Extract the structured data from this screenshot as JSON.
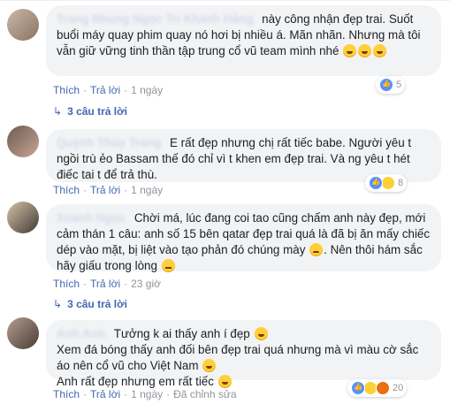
{
  "comments": [
    {
      "author": "Trang Nhung Ngọc Trí Khánh Hằng",
      "text": "này công nhận đẹp trai. Suốt buổi máy quay phim quay nó hơi bị nhiều á. Mãn nhãn. Nhưng mà tôi vẫn giữ vững tinh thần tập trung cổ vũ team mình nhé",
      "like_label": "Thích",
      "reply_label": "Trả lời",
      "time": "1 ngày",
      "reaction_count": "5",
      "replies_label": "3 câu trả lời"
    },
    {
      "author": "Quỳnh Thủy Trang",
      "text": "E rất đẹp nhưng chị rất tiếc babe. Người yêu t ngồi trù ẻo Bassam thế đó chỉ vì t khen em đẹp trai. Và ng yêu t hét điếc tai t để trả thù.",
      "like_label": "Thích",
      "reply_label": "Trả lời",
      "time": "1 ngày",
      "reaction_count": "8"
    },
    {
      "author": "Xoanh Ngọc",
      "text": "Chời má, lúc đang coi tao cũng chấm anh này đẹp, mới cảm thán 1 câu: anh số 15 bên qatar đẹp trai quá là đã bị ăn mấy chiếc dép vào mặt, bị liệt vào tạo phản đó chúng mày",
      "text_tail": ". Nên thôi hám sắc hãy giấu trong lòng",
      "like_label": "Thích",
      "reply_label": "Trả lời",
      "time": "23 giờ",
      "replies_label": "3 câu trả lời"
    },
    {
      "author": "Anh Anh",
      "line1": "Tưởng k ai thấy anh í đẹp",
      "line2": "Xem đá bóng thấy anh đối bên đẹp trai quá nhưng mà vì màu cờ sắc áo nên cổ vũ cho Việt Nam",
      "line3": "Anh rất đẹp nhưng em rất tiếc",
      "like_label": "Thích",
      "reply_label": "Trả lời",
      "time": "1 ngày",
      "edited_label": "Đã chỉnh sửa",
      "reaction_count": "20"
    }
  ]
}
